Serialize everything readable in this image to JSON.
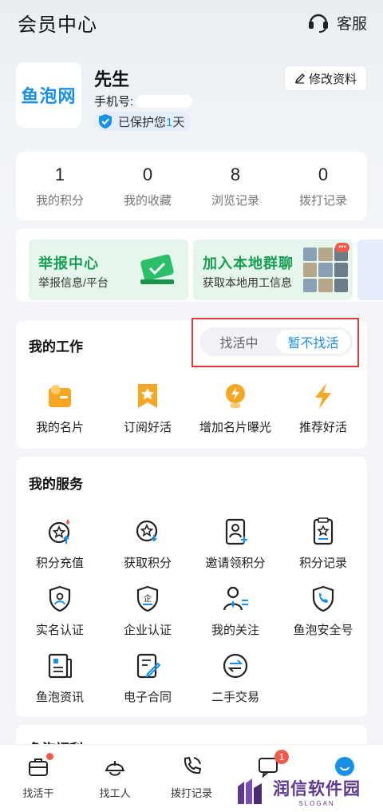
{
  "header": {
    "title": "会员中心",
    "service_label": "客服"
  },
  "profile": {
    "logo_text": "鱼泡网",
    "name": "先生",
    "phone_label": "手机号:",
    "protect_prefix": "已保护您",
    "protect_days": "1",
    "protect_suffix": "天",
    "edit_label": "修改资料"
  },
  "stats": [
    {
      "value": "1",
      "label": "我的积分"
    },
    {
      "value": "0",
      "label": "我的收藏"
    },
    {
      "value": "8",
      "label": "浏览记录"
    },
    {
      "value": "0",
      "label": "拨打记录"
    }
  ],
  "banners": [
    {
      "title": "举报中心",
      "subtitle": "举报信息/平台"
    },
    {
      "title": "加入本地群聊",
      "subtitle": "获取本地用工信息"
    }
  ],
  "work": {
    "title": "我的工作",
    "toggle_options": [
      "找活中",
      "暂不找活"
    ],
    "toggle_selected": "暂不找活",
    "items": [
      {
        "label": "我的名片",
        "icon": "business-card-icon"
      },
      {
        "label": "订阅好活",
        "icon": "subscribe-star-icon"
      },
      {
        "label": "增加名片曝光",
        "icon": "lightbulb-icon"
      },
      {
        "label": "推荐好活",
        "icon": "lightning-icon"
      }
    ]
  },
  "services": {
    "title": "我的服务",
    "items": [
      {
        "label": "积分充值",
        "icon": "points-recharge-icon"
      },
      {
        "label": "获取积分",
        "icon": "get-points-icon"
      },
      {
        "label": "邀请领积分",
        "icon": "invite-icon"
      },
      {
        "label": "积分记录",
        "icon": "points-record-icon"
      },
      {
        "label": "实名认证",
        "icon": "id-verify-icon"
      },
      {
        "label": "企业认证",
        "icon": "enterprise-verify-icon"
      },
      {
        "label": "我的关注",
        "icon": "follow-icon"
      },
      {
        "label": "鱼泡安全号",
        "icon": "safe-phone-icon"
      },
      {
        "label": "鱼泡资讯",
        "icon": "news-icon"
      },
      {
        "label": "电子合同",
        "icon": "contract-icon"
      },
      {
        "label": "二手交易",
        "icon": "trade-icon"
      }
    ]
  },
  "welfare": {
    "title": "鱼泡福利"
  },
  "tabbar": [
    {
      "label": "找活干",
      "icon": "briefcase-icon"
    },
    {
      "label": "找工人",
      "icon": "helmet-icon"
    },
    {
      "label": "拨打记录",
      "icon": "phone-icon"
    },
    {
      "label": "",
      "icon": "message-icon",
      "badge": "1"
    },
    {
      "label": "",
      "icon": "profile-icon"
    }
  ],
  "watermark": {
    "text": "润信软件园",
    "sub": "SLOGAN"
  },
  "colors": {
    "accent": "#1a8fe6",
    "green": "#15a052",
    "orange": "#f5a623",
    "highlight_border": "#e23a3a"
  }
}
